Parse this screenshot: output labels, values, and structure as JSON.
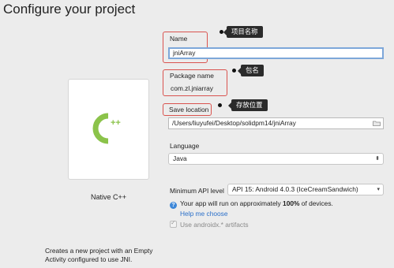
{
  "page_title": "Configure your project",
  "template": {
    "logo_text": "C++",
    "name": "Native C++",
    "description_line1": "Creates a new project with an Empty",
    "description_line2": "Activity configured to use JNI."
  },
  "form": {
    "name_label": "Name",
    "name_value": "jniArray",
    "package_label": "Package name",
    "package_value": "com.zl.jniarray",
    "save_label": "Save location",
    "save_value": "/Users/liuyufei/Desktop/solidpm14/jniArray",
    "language_label": "Language",
    "language_value": "Java",
    "api_label": "Minimum API level",
    "api_value": "API 15: Android 4.0.3 (IceCreamSandwich)",
    "info_prefix": "Your app will run on approximately ",
    "info_percent": "100%",
    "info_suffix": " of devices.",
    "help_link": "Help me choose",
    "androidx_label": "Use androidx.* artifacts"
  },
  "annotations": {
    "name_tag": "项目名称",
    "package_tag": "包名",
    "save_tag": "存放位置",
    "highlight_color": "#d9534f"
  },
  "colors": {
    "logo_green": "#8bc34a",
    "link_blue": "#2a6fc9",
    "focus_blue": "#7da7d9"
  }
}
